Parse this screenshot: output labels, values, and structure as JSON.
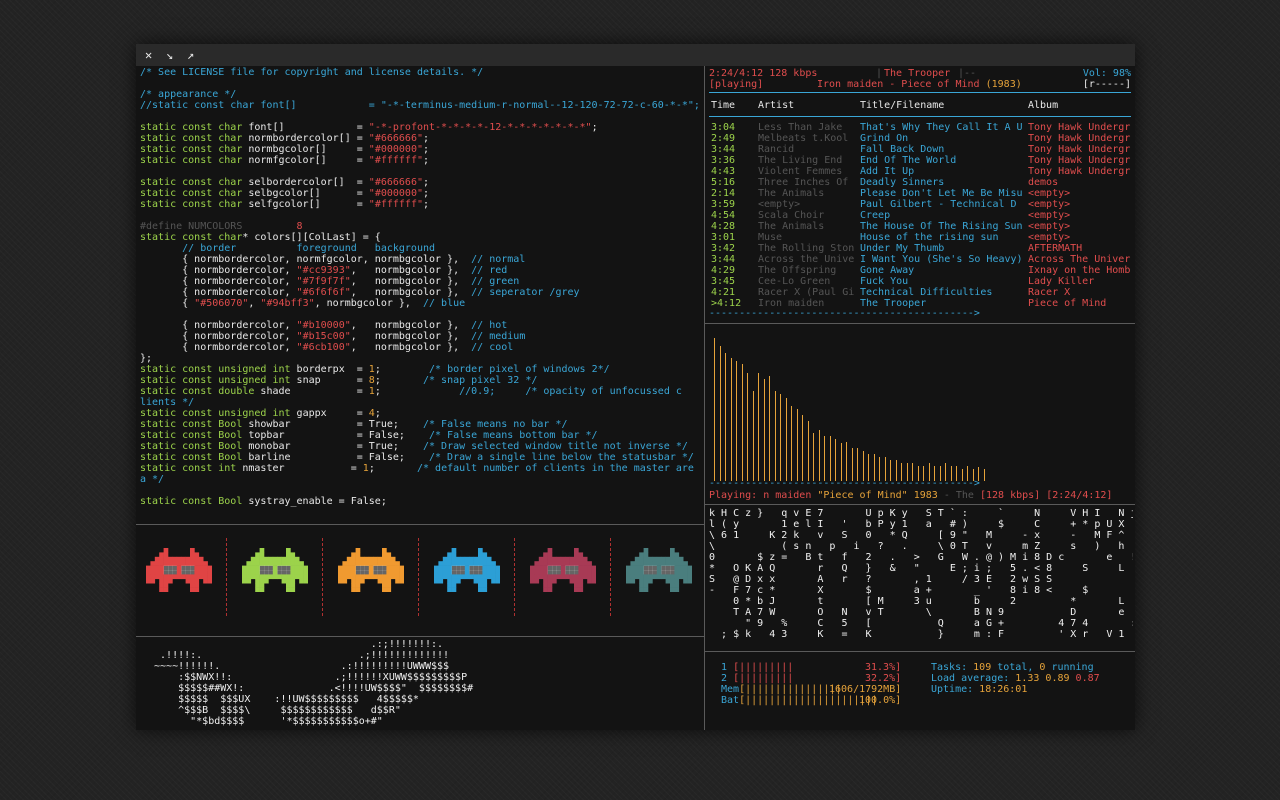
{
  "window": {
    "close_icon": "✕",
    "minimize_icon": "↘",
    "maximize_icon": "↗"
  },
  "code": [
    [
      [
        "/* See LICENSE file for copyright and license details. */",
        "cm"
      ]
    ],
    [],
    [
      [
        "/* appearance */",
        "cm"
      ]
    ],
    [
      [
        "//static const char font[]            = \"-*-terminus-medium-r-normal--12-120-72-72-c-60-*-*\";",
        "cm"
      ]
    ],
    [],
    [
      [
        "static const char ",
        "kw"
      ],
      [
        "font[]            = ",
        "pl"
      ],
      [
        "\"-*-profont-*-*-*-*-12-*-*-*-*-*-*-*\"",
        "st"
      ],
      [
        ";",
        "pl"
      ]
    ],
    [
      [
        "static const char ",
        "kw"
      ],
      [
        "normbordercolor[] = ",
        "pl"
      ],
      [
        "\"#666666\"",
        "st"
      ],
      [
        ";",
        "pl"
      ]
    ],
    [
      [
        "static const char ",
        "kw"
      ],
      [
        "normbgcolor[]     = ",
        "pl"
      ],
      [
        "\"#000000\"",
        "st"
      ],
      [
        ";",
        "pl"
      ]
    ],
    [
      [
        "static const char ",
        "kw"
      ],
      [
        "normfgcolor[]     = ",
        "pl"
      ],
      [
        "\"#ffffff\"",
        "st"
      ],
      [
        ";",
        "pl"
      ]
    ],
    [],
    [
      [
        "static const char ",
        "kw"
      ],
      [
        "selbordercolor[]  = ",
        "pl"
      ],
      [
        "\"#666666\"",
        "st"
      ],
      [
        ";",
        "pl"
      ]
    ],
    [
      [
        "static const char ",
        "kw"
      ],
      [
        "selbgcolor[]      = ",
        "pl"
      ],
      [
        "\"#000000\"",
        "st"
      ],
      [
        ";",
        "pl"
      ]
    ],
    [
      [
        "static const char ",
        "kw"
      ],
      [
        "selfgcolor[]      = ",
        "pl"
      ],
      [
        "\"#ffffff\"",
        "st"
      ],
      [
        ";",
        "pl"
      ]
    ],
    [],
    [
      [
        "#define NUMCOLORS         ",
        "dim"
      ],
      [
        "8",
        "st"
      ]
    ],
    [
      [
        "static const char",
        "kw"
      ],
      [
        "* colors[][ColLast] = {",
        "pl"
      ]
    ],
    [
      [
        "       // border          foreground   background",
        "cm"
      ]
    ],
    [
      [
        "       { normbordercolor, normfgcolor, normbgcolor },  ",
        "pl"
      ],
      [
        "// normal",
        "cm"
      ]
    ],
    [
      [
        "       { normbordercolor, ",
        "pl"
      ],
      [
        "\"#cc9393\"",
        "st"
      ],
      [
        ",   normbgcolor },  ",
        "pl"
      ],
      [
        "// red",
        "cm"
      ]
    ],
    [
      [
        "       { normbordercolor, ",
        "pl"
      ],
      [
        "\"#7f9f7f\"",
        "st"
      ],
      [
        ",   normbgcolor },  ",
        "pl"
      ],
      [
        "// green",
        "cm"
      ]
    ],
    [
      [
        "       { normbordercolor, ",
        "pl"
      ],
      [
        "\"#6f6f6f\"",
        "st"
      ],
      [
        ",   normbgcolor },  ",
        "pl"
      ],
      [
        "// seperator /grey",
        "cm"
      ]
    ],
    [
      [
        "       { ",
        "pl"
      ],
      [
        "\"#506070\"",
        "st"
      ],
      [
        ", ",
        "pl"
      ],
      [
        "\"#94bff3\"",
        "st"
      ],
      [
        ", normbgcolor },  ",
        "pl"
      ],
      [
        "// blue",
        "cm"
      ]
    ],
    [],
    [
      [
        "       { normbordercolor, ",
        "pl"
      ],
      [
        "\"#b10000\"",
        "st"
      ],
      [
        ",   normbgcolor },  ",
        "pl"
      ],
      [
        "// hot",
        "cm"
      ]
    ],
    [
      [
        "       { normbordercolor, ",
        "pl"
      ],
      [
        "\"#b15c00\"",
        "st"
      ],
      [
        ",   normbgcolor },  ",
        "pl"
      ],
      [
        "// medium",
        "cm"
      ]
    ],
    [
      [
        "       { normbordercolor, ",
        "pl"
      ],
      [
        "\"#6cb100\"",
        "st"
      ],
      [
        ",   normbgcolor },  ",
        "pl"
      ],
      [
        "// cool",
        "cm"
      ]
    ],
    [
      [
        "};",
        "pl"
      ]
    ],
    [
      [
        "static const unsigned int ",
        "kw"
      ],
      [
        "borderpx  = ",
        "pl"
      ],
      [
        "1",
        "nm"
      ],
      [
        ";        ",
        "pl"
      ],
      [
        "/* border pixel of windows 2*/",
        "cm"
      ]
    ],
    [
      [
        "static const unsigned int ",
        "kw"
      ],
      [
        "snap      = ",
        "pl"
      ],
      [
        "8",
        "nm"
      ],
      [
        ";       ",
        "pl"
      ],
      [
        "/* snap pixel 32 */",
        "cm"
      ]
    ],
    [
      [
        "static const double ",
        "kw"
      ],
      [
        "shade           = ",
        "pl"
      ],
      [
        "1",
        "nm"
      ],
      [
        ";             ",
        "pl"
      ],
      [
        "//0.9;     /* opacity of unfocussed c",
        "cm"
      ]
    ],
    [
      [
        "lients */",
        "cm"
      ]
    ],
    [
      [
        "static const unsigned int ",
        "kw"
      ],
      [
        "gappx     = ",
        "pl"
      ],
      [
        "4",
        "nm"
      ],
      [
        ";",
        "pl"
      ]
    ],
    [
      [
        "static const Bool ",
        "kw"
      ],
      [
        "showbar           = True;    ",
        "pl"
      ],
      [
        "/* False means no bar */",
        "cm"
      ]
    ],
    [
      [
        "static const Bool ",
        "kw"
      ],
      [
        "topbar            = False;    ",
        "pl"
      ],
      [
        "/* False means bottom bar */",
        "cm"
      ]
    ],
    [
      [
        "static const Bool ",
        "kw"
      ],
      [
        "monobar           = True;    ",
        "pl"
      ],
      [
        "/* Draw selected window title not inverse */",
        "cm"
      ]
    ],
    [
      [
        "static const Bool ",
        "kw"
      ],
      [
        "barline           = False;    ",
        "pl"
      ],
      [
        "/* Draw a single line below the statusbar */",
        "cm"
      ]
    ],
    [
      [
        "static const int ",
        "kw"
      ],
      [
        "nmaster           = ",
        "pl"
      ],
      [
        "1",
        "nm"
      ],
      [
        ";       ",
        "pl"
      ],
      [
        "/* default number of clients in the master are",
        "cm"
      ]
    ],
    [
      [
        "a */",
        "cm"
      ]
    ],
    [],
    [
      [
        "static const Bool ",
        "kw"
      ],
      [
        "systray_enable = False;",
        "pl"
      ]
    ]
  ],
  "invader_colors": [
    "#e04444",
    "#9cd34b",
    "#f09a30",
    "#2c9fd6",
    "#a83a55",
    "#4a7e7e"
  ],
  "ascii_art": [
    "                                     .:;!!!!!!!:.",
    "  .!!!!:.                          .;!!!!!!!!!!!!!",
    " ~~~~!!!!!!.                    .:!!!!!!!!!UWWW$$$",
    "     :$$NWX!!:                 .;!!!!!!XUWW$$$$$$$$$P",
    "     $$$$$##WX!:              .<!!!!UW$$$$\"  $$$$$$$$#",
    "     $$$$$  $$$UX    :!!UW$$$$$$$$$   4$$$$$*",
    "     ^$$$B  $$$$\\     $$$$$$$$$$$$   d$$R\"",
    "       \"*$bd$$$$      '*$$$$$$$$$$$o+#\""
  ],
  "mpd": {
    "elapsed": "2:24/4:12",
    "bitrate": "128 kbps",
    "now_title": "The Trooper",
    "volume": "Vol: 98%",
    "status": "[playing]",
    "now_artist": "Iron maiden",
    "now_album_sep": " - ",
    "now_album": "Piece of Mind",
    "now_year": "(1983)",
    "modes": "[r-----]",
    "headers": {
      "time": "Time",
      "artist": "Artist",
      "title": "Title/Filename",
      "album": "Album"
    },
    "tracks": [
      {
        "time": "3:04",
        "artist": "Less Than Jake",
        "title": "That's Why They Call It A U",
        "album": "Tony Hawk Undergr"
      },
      {
        "time": "2:49",
        "artist": "Melbeats t.Kool",
        "title": "Grind On",
        "album": "Tony Hawk Undergr"
      },
      {
        "time": "3:44",
        "artist": "Rancid",
        "title": "Fall Back Down",
        "album": "Tony Hawk Undergr"
      },
      {
        "time": "3:36",
        "artist": "The Living End",
        "title": "End Of The World",
        "album": "Tony Hawk Undergr"
      },
      {
        "time": "4:43",
        "artist": "Violent Femmes",
        "title": "Add It Up",
        "album": "Tony Hawk Undergr"
      },
      {
        "time": "5:16",
        "artist": "Three Inches Of",
        "title": "Deadly Sinners",
        "album": "demos"
      },
      {
        "time": "2:14",
        "artist": "The Animals",
        "title": "Please Don't Let Me Be Misu",
        "album": "<empty>"
      },
      {
        "time": "3:59",
        "artist": "<empty>",
        "title": "Paul Gilbert  - Technical D",
        "album": "<empty>"
      },
      {
        "time": "4:54",
        "artist": "Scala Choir",
        "title": "Creep",
        "album": "<empty>"
      },
      {
        "time": "4:28",
        "artist": "The Animals",
        "title": "The House Of The Rising Sun",
        "album": "<empty>"
      },
      {
        "time": "3:01",
        "artist": "Muse",
        "title": "House of the rising sun",
        "album": "<empty>"
      },
      {
        "time": "3:42",
        "artist": "The Rolling Ston",
        "title": "Under My Thumb",
        "album": "AFTERMATH"
      },
      {
        "time": "3:44",
        "artist": "Across the Unive",
        "title": "I Want You (She's So Heavy)",
        "album": "Across The Univer"
      },
      {
        "time": "4:29",
        "artist": "The Offspring",
        "title": "Gone Away",
        "album": "Ixnay on the Homb"
      },
      {
        "time": "3:45",
        "artist": "Cee-Lo Green",
        "title": "Fuck You",
        "album": "Lady Killer"
      },
      {
        "time": "4:21",
        "artist": "Racer X (Paul Gi",
        "title": "Technical Difficulties",
        "album": "Racer X"
      },
      {
        "time": ">4:12",
        "artist": "Iron maiden",
        "title": "The Trooper",
        "album": "Piece of Mind"
      }
    ],
    "progress_line": "-------------------------------------------->",
    "viz_levels": [
      0.95,
      0.9,
      0.85,
      0.82,
      0.8,
      0.78,
      0.72,
      0.6,
      0.72,
      0.68,
      0.7,
      0.6,
      0.58,
      0.55,
      0.5,
      0.48,
      0.44,
      0.4,
      0.32,
      0.34,
      0.3,
      0.3,
      0.28,
      0.25,
      0.26,
      0.22,
      0.22,
      0.2,
      0.18,
      0.18,
      0.16,
      0.16,
      0.14,
      0.14,
      0.12,
      0.12,
      0.12,
      0.1,
      0.1,
      0.12,
      0.1,
      0.1,
      0.12,
      0.1,
      0.1,
      0.08,
      0.1,
      0.08,
      0.09,
      0.08
    ],
    "bottom": {
      "label": "Playing: ",
      "artist_frag": "n maiden ",
      "title_q": "\"Piece of Mind\"",
      "year": "1983",
      "trail": " - The ",
      "bitrate": "[128 kbps]",
      "pos": "[2:24/4:12]"
    }
  },
  "matrix": [
    "k H C z }   q v E 7       U p K y   S T ` :     `     N     V H I   N j",
    "l ( y       1 e l I   '   b P y 1   a   # )     $     C     + * p U X",
    "\\ 6 1     K 2 k   v   S   0   * Q     [ 9 \"   M     - x     -   M F ^",
    "\\           ( s n   p   i   ?   .     \\ 0 T   v     m Z     s   )   h",
    "0       $ z =   B t   f   2   .   >   G   W . @ ) M i 8 D c       e   !",
    "*   O K A Q       r   Q   }   &   \"     E ; i ;   5 . < 8     S     L",
    "S   @ D x x       A   r   ?       , 1     / 3 E   2 w S S",
    "-   F 7 c *       X       $       a +       _ '   8 i 8 <     $",
    "    0 * b J       t       [ M     3 u       b     2         *       L",
    "    T A 7 W       O   N   v T       \\       B N 9           D       e",
    "      \" 9   %     C   5   [           Q     a G +         4 7 4       :",
    "  ; $ k   4 3     K   =   K           }     m : F         ' X r   V 1"
  ],
  "htop": {
    "cpu1_label": "1",
    "cpu1_bar": "[|||||||||",
    "cpu1_pct": "31.3%]",
    "cpu1_val": 0.313,
    "cpu2_label": "2",
    "cpu2_bar": "[|||||||||",
    "cpu2_pct": "32.2%]",
    "cpu2_val": 0.322,
    "mem_label": "Mem",
    "mem_bar": "[||||||||||||||||",
    "mem_val_text": "1606/1792MB]",
    "mem_val": 0.896,
    "bat_label": "Bat",
    "bat_bar": "[||||||||||||||||||||||",
    "bat_val_text": "100.0%]",
    "bat_val": 1.0,
    "tasks_label": "Tasks: ",
    "tasks_total": "109",
    "tasks_mid": " total, ",
    "tasks_running": "0",
    "tasks_end": " running",
    "load_label": "Load average: ",
    "load1": "1.33",
    "load5": "0.89",
    "load15": "0.87",
    "uptime_label": "Uptime: ",
    "uptime": "18:26:01"
  }
}
